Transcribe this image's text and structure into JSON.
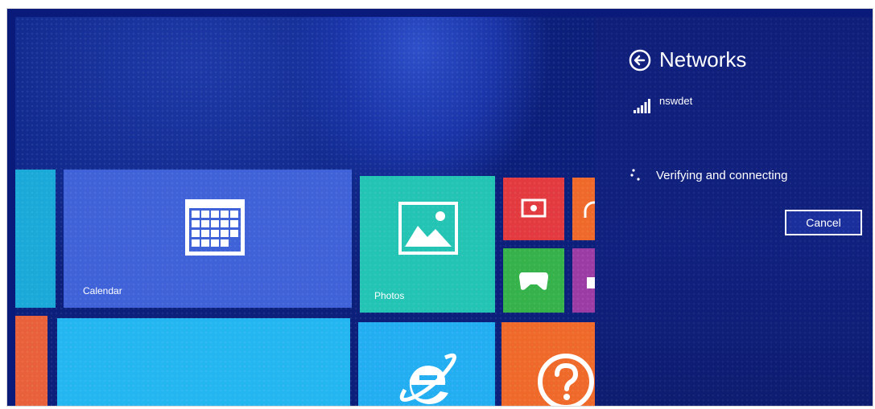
{
  "start_screen": {
    "tiles": {
      "calendar": {
        "label": "Calendar"
      },
      "photos": {
        "label": "Photos"
      }
    }
  },
  "networks_pane": {
    "title": "Networks",
    "network": {
      "name": "nswdet"
    },
    "status": "Verifying and connecting",
    "cancel_label": "Cancel"
  }
}
